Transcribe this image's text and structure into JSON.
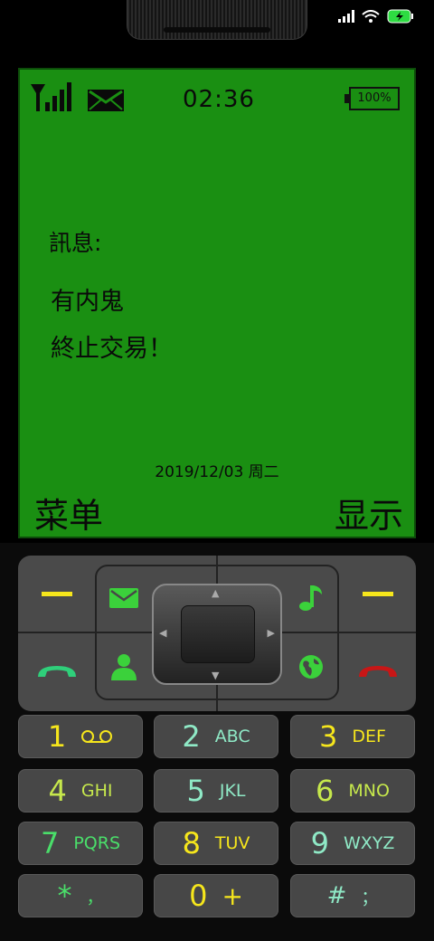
{
  "system": {
    "icons": [
      "signal-icon",
      "wifi-icon",
      "battery-charging-icon"
    ]
  },
  "phone": {
    "status": {
      "time": "02:36",
      "battery": "100%"
    },
    "message": {
      "label": "訊息:",
      "lines": [
        "有内鬼",
        "終止交易！"
      ]
    },
    "date": "2019/12/03 周二",
    "softkeys": {
      "left": "菜单",
      "right": "显示"
    }
  },
  "keys": [
    {
      "num": "1",
      "letters": "",
      "color": "#f6e61c",
      "lcolor": "#f6e61c"
    },
    {
      "num": "2",
      "letters": "ABC",
      "color": "#8fe9c6",
      "lcolor": "#8fe9c6"
    },
    {
      "num": "3",
      "letters": "DEF",
      "color": "#f6e61c",
      "lcolor": "#f6e61c"
    },
    {
      "num": "4",
      "letters": "GHI",
      "color": "#c6e84c",
      "lcolor": "#c6e84c"
    },
    {
      "num": "5",
      "letters": "JKL",
      "color": "#8fe9c6",
      "lcolor": "#8fe9c6"
    },
    {
      "num": "6",
      "letters": "MNO",
      "color": "#c6e84c",
      "lcolor": "#c6e84c"
    },
    {
      "num": "7",
      "letters": "PQRS",
      "color": "#4ade6a",
      "lcolor": "#4ade6a"
    },
    {
      "num": "8",
      "letters": "TUV",
      "color": "#f6e61c",
      "lcolor": "#f6e61c"
    },
    {
      "num": "9",
      "letters": "WXYZ",
      "color": "#8fe9c6",
      "lcolor": "#8fe9c6"
    },
    {
      "num": "*",
      "letters": "，",
      "color": "#4ade6a",
      "lcolor": "#4ade6a"
    },
    {
      "num": "0",
      "letters": "+",
      "color": "#f6e61c",
      "lcolor": "#f6e61c"
    },
    {
      "num": "#",
      "letters": "；",
      "color": "#8fe9c6",
      "lcolor": "#8fe9c6"
    }
  ],
  "colors": {
    "screen": "#1a8f12",
    "accent": "#f6e61c",
    "call": "#2fcf7a",
    "end": "#c81616",
    "icon": "#3bd13b"
  }
}
